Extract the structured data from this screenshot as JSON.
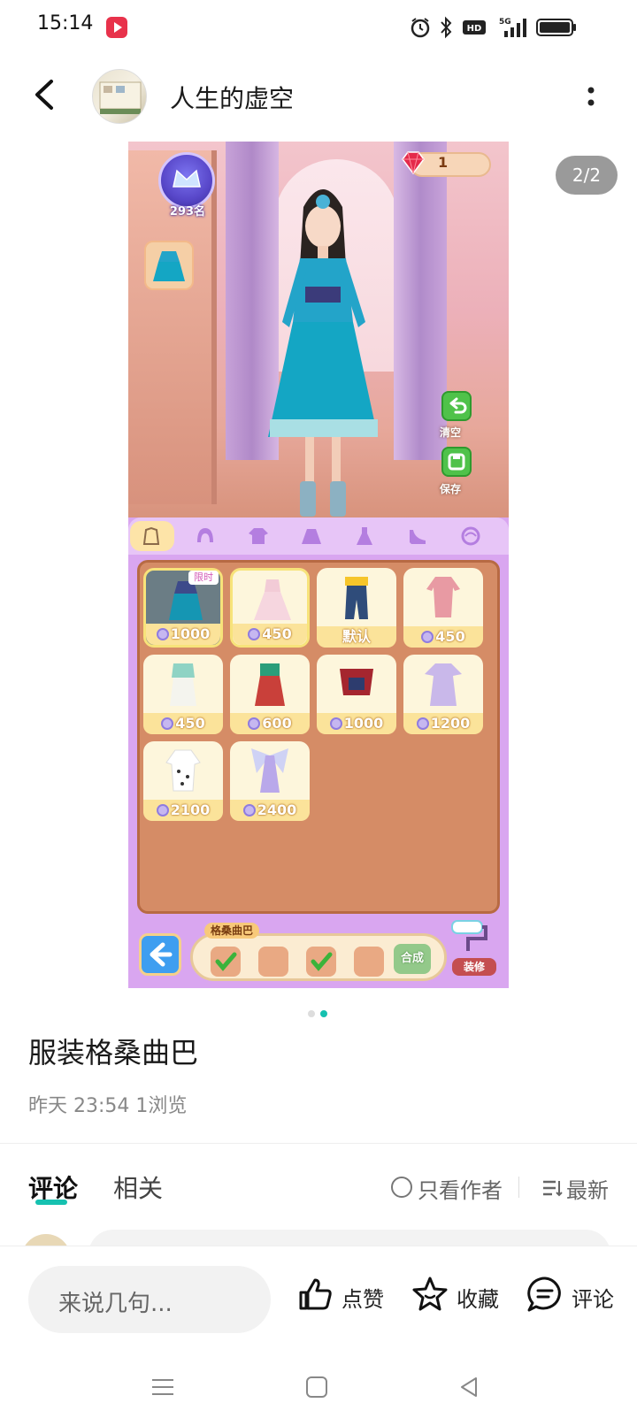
{
  "status_bar": {
    "time": "15:14",
    "icons": [
      "video-app-icon",
      "alarm-icon",
      "bluetooth-icon",
      "hd-icon",
      "5g-signal-icon",
      "battery-icon"
    ]
  },
  "header": {
    "back_icon": "chevron-left-icon",
    "author_name": "人生的虚空",
    "more_icon": "more-vertical-icon"
  },
  "carousel": {
    "page_counter": "2/2",
    "current_page": 2,
    "total_pages": 2,
    "game": {
      "rank_label": "293名",
      "gem_count": "1",
      "clear_label": "清空",
      "save_label": "保存",
      "tabs": [
        "outfit-set-icon",
        "hair-icon",
        "top-icon",
        "skirt-icon",
        "dress-icon",
        "shoes-icon",
        "accessory-icon"
      ],
      "items": [
        {
          "price": "1000",
          "coin": true,
          "limited": "限时",
          "state": "equipped"
        },
        {
          "price": "450",
          "coin": true,
          "limited": "",
          "state": "selected"
        },
        {
          "price": "默认",
          "coin": false,
          "limited": "",
          "state": ""
        },
        {
          "price": "450",
          "coin": true,
          "limited": "",
          "state": ""
        },
        {
          "price": "450",
          "coin": true,
          "limited": "",
          "state": ""
        },
        {
          "price": "600",
          "coin": true,
          "limited": "",
          "state": ""
        },
        {
          "price": "1000",
          "coin": true,
          "limited": "",
          "state": ""
        },
        {
          "price": "1200",
          "coin": true,
          "limited": "",
          "state": ""
        },
        {
          "price": "2100",
          "coin": true,
          "limited": "",
          "state": ""
        },
        {
          "price": "2400",
          "coin": true,
          "limited": "",
          "state": ""
        }
      ],
      "recipe_title": "格桑曲巴",
      "synth_label": "合成",
      "repair_label": "装修"
    }
  },
  "post": {
    "title": "服装格桑曲巴",
    "meta": "昨天 23:54  1浏览"
  },
  "comments_section": {
    "tab_comments": "评论",
    "tab_related": "相关",
    "author_only": "只看作者",
    "sort_label": "最新"
  },
  "action_bar": {
    "input_placeholder": "来说几句...",
    "like_label": "点赞",
    "favorite_label": "收藏",
    "comment_label": "评论"
  },
  "colors": {
    "accent": "#16c1b0",
    "closet_purple": "#d9a6f0",
    "closet_brown": "#d58c66"
  }
}
